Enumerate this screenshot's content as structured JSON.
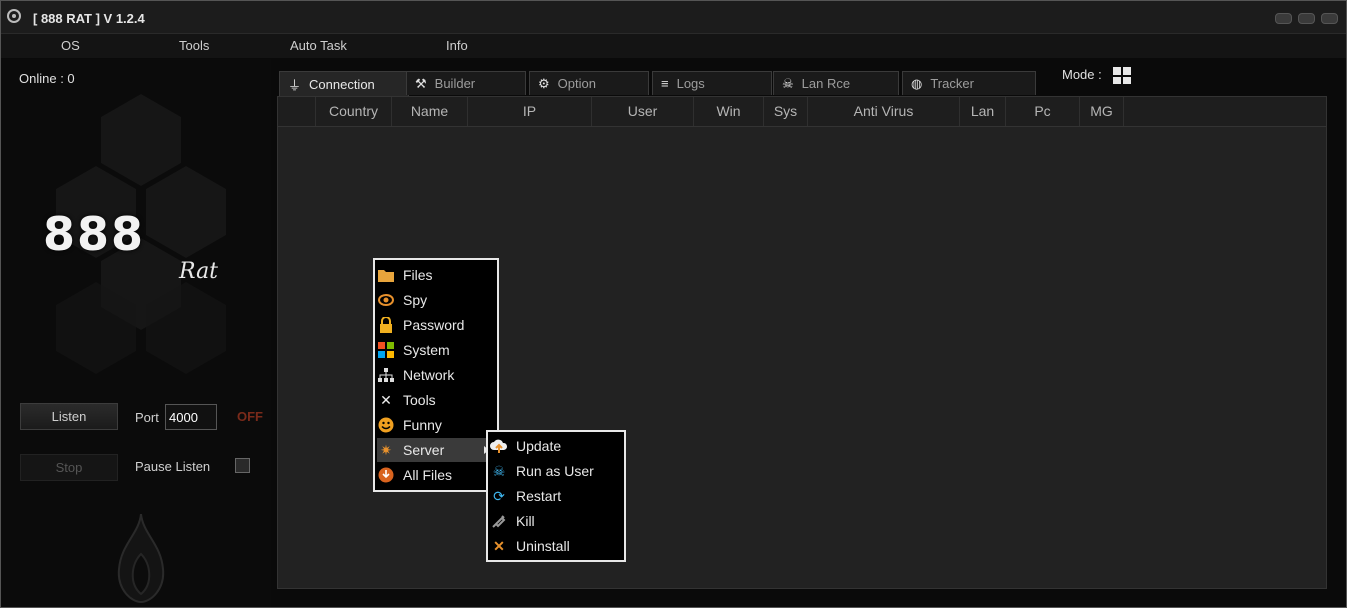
{
  "window": {
    "title": "[ 888 RAT ] V 1.2.4"
  },
  "menubar": {
    "items": [
      "OS",
      "Tools",
      "Auto Task",
      "Info"
    ]
  },
  "left": {
    "online": "Online : 0",
    "logo_main": "888",
    "logo_sub": "Rat",
    "listen_label": "Listen",
    "port_label": "Port",
    "port_value": "4000",
    "status": "OFF",
    "stop_label": "Stop",
    "pause_label": "Pause Listen"
  },
  "tabs": [
    {
      "label": "Connection",
      "icon": "plug-icon"
    },
    {
      "label": "Builder",
      "icon": "tools-icon"
    },
    {
      "label": "Option",
      "icon": "gear-icon"
    },
    {
      "label": "Logs",
      "icon": "database-icon"
    },
    {
      "label": "Lan Rce",
      "icon": "skull-icon"
    },
    {
      "label": "Tracker",
      "icon": "globe-icon"
    }
  ],
  "mode": {
    "label": "Mode :",
    "icon": "windows-icon"
  },
  "grid": {
    "columns": [
      "Country",
      "Name",
      "IP",
      "User",
      "Win",
      "Sys",
      "Anti Virus",
      "Lan",
      "Pc",
      "MG"
    ]
  },
  "context_menu": {
    "items": [
      {
        "label": "Files",
        "icon": "folder-icon"
      },
      {
        "label": "Spy",
        "icon": "eye-icon"
      },
      {
        "label": "Password",
        "icon": "lock-icon"
      },
      {
        "label": "System",
        "icon": "windows-icon"
      },
      {
        "label": "Network",
        "icon": "network-icon"
      },
      {
        "label": "Tools",
        "icon": "tools-icon"
      },
      {
        "label": "Funny",
        "icon": "smiley-icon"
      },
      {
        "label": "Server",
        "icon": "server-icon"
      },
      {
        "label": "All Files",
        "icon": "download-icon"
      }
    ]
  },
  "submenu": {
    "items": [
      {
        "label": "Update",
        "icon": "cloud-upload-icon"
      },
      {
        "label": "Run as User",
        "icon": "skull-icon"
      },
      {
        "label": "Restart",
        "icon": "refresh-icon"
      },
      {
        "label": "Kill",
        "icon": "syringe-icon"
      },
      {
        "label": "Uninstall",
        "icon": "close-icon"
      }
    ]
  },
  "colors": {
    "accent_orange": "#e8912c",
    "off_red": "#7a2a1a",
    "menu_border": "#e8e8e8"
  }
}
